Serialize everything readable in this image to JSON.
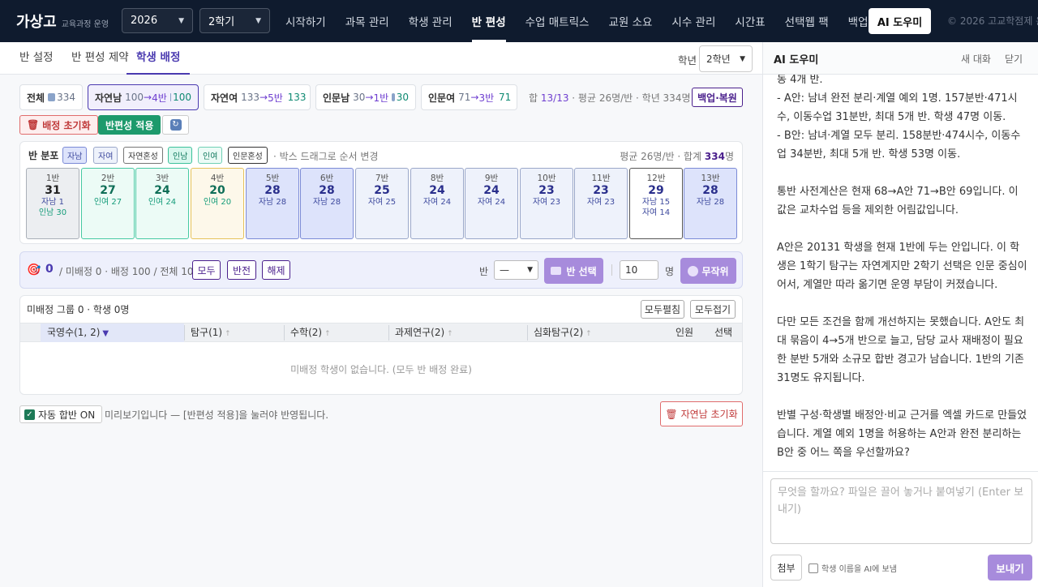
{
  "header": {
    "logo": "가상고",
    "logo_sub": "교육과정 운영",
    "year": "2026",
    "semester": "2학기",
    "nav": [
      "시작하기",
      "과목 관리",
      "학생 관리",
      "반 편성",
      "수업 매트릭스",
      "교원 소요",
      "시수 관리",
      "시간표",
      "선택웹 팩",
      "백업"
    ],
    "active_nav": "반 편성",
    "ai_button": "AI 도우미",
    "copyright": "© 2026 고교학점제 운영"
  },
  "subtabs": [
    "반 설정",
    "반 편성 제약",
    "학생 배정"
  ],
  "active_subtab": "학생 배정",
  "grade": {
    "label": "학년",
    "value": "2학년"
  },
  "filters": [
    {
      "label": "전체",
      "value": "334"
    },
    {
      "label": "자연남",
      "from": "100",
      "arrow": "→",
      "to": "4반",
      "value": "100"
    },
    {
      "label": "자연여",
      "from": "133",
      "arrow": "→",
      "to": "5반",
      "value": "133"
    },
    {
      "label": "인문남",
      "from": "30",
      "arrow": "→",
      "to": "1반",
      "value": "30"
    },
    {
      "label": "인문여",
      "from": "71",
      "arrow": "→",
      "to": "3반",
      "value": "71"
    }
  ],
  "summary": {
    "prefix": "합",
    "ratio": "13/13",
    "rest": "· 평균 26명/반 · 학년 334명"
  },
  "buttons": {
    "backup": "백업·복원",
    "reset": "배정 초기화",
    "apply": "반편성 적용"
  },
  "distribution": {
    "title": "반 분포",
    "legend": [
      "자남",
      "자여",
      "자연혼성",
      "인남",
      "인여",
      "인문혼성"
    ],
    "hint": "· 박스 드래그로 순서 변경",
    "total_prefix": "평균 26명/반 · 합계",
    "total": "334",
    "total_suffix": "명",
    "classes": [
      {
        "name": "1반",
        "count": "31",
        "lines": [
          "자남 1",
          "인남 30"
        ]
      },
      {
        "name": "2반",
        "count": "27",
        "lines": [
          "인여 27"
        ]
      },
      {
        "name": "3반",
        "count": "24",
        "lines": [
          "인여 24"
        ]
      },
      {
        "name": "4반",
        "count": "20",
        "lines": [
          "인여 20"
        ]
      },
      {
        "name": "5반",
        "count": "28",
        "lines": [
          "자남 28"
        ]
      },
      {
        "name": "6반",
        "count": "28",
        "lines": [
          "자남 28"
        ]
      },
      {
        "name": "7반",
        "count": "25",
        "lines": [
          "자여 25"
        ]
      },
      {
        "name": "8반",
        "count": "24",
        "lines": [
          "자여 24"
        ]
      },
      {
        "name": "9반",
        "count": "24",
        "lines": [
          "자여 24"
        ]
      },
      {
        "name": "10반",
        "count": "23",
        "lines": [
          "자여 23"
        ]
      },
      {
        "name": "11반",
        "count": "23",
        "lines": [
          "자여 23"
        ]
      },
      {
        "name": "12반",
        "count": "29",
        "lines": [
          "자남 15",
          "자여 14"
        ]
      },
      {
        "name": "13반",
        "count": "28",
        "lines": [
          "자남 28"
        ]
      }
    ]
  },
  "selection": {
    "count": "0",
    "text": "/ 미배정 0 · 배정 100 / 전체 100",
    "all": "모두",
    "invert": "반전",
    "clear": "해제",
    "ban_label": "반",
    "ban_value": "—",
    "ban_select": "반 선택",
    "num": "10",
    "num_unit": "명",
    "random": "무작위"
  },
  "unassigned": {
    "title": "미배정 그룹 0 · 학생 0명",
    "expand": "모두펼침",
    "collapse": "모두접기",
    "columns": [
      "국영수(1, 2)",
      "탐구(1)",
      "수학(2)",
      "과제연구(2)",
      "심화탐구(2)",
      "인원",
      "선택"
    ],
    "empty": "미배정 학생이 없습니다. (모두 반 배정 완료)"
  },
  "footer": {
    "auto_merge": "자동 합반 ON",
    "preview_note": "미리보기입니다 — [반편성 적용]을 눌러야 반영됩니다.",
    "reset_nature_m": "자연남 초기화"
  },
  "assistant": {
    "title": "AI 도우미",
    "new_chat": "새 대화",
    "close": "닫기",
    "message": "동 4개 반.\n- A안: 남녀 완전 분리·계열 예외 1명. 157분반·471시수, 이동수업 31분반, 최대 5개 반. 학생 47명 이동.\n- B안: 남녀·계열 모두 분리. 158분반·474시수, 이동수업 34분반, 최대 5개 반. 학생 53명 이동.\n\n통반 사전계산은 현재 68→A안 71→B안 69입니다. 이 값은 교차수업 등을 제외한 어림값입니다.\n\nA안은 20131 학생을 현재 1반에 두는 안입니다. 이 학생은 1학기 탐구는 자연계지만 2학기 선택은 인문 중심이어서, 계열만 따라 옮기면 운영 부담이 커졌습니다.\n\n다만 모든 조건을 함께 개선하지는 못했습니다. A안도 최대 묶음이 4→5개 반으로 늘고, 담당 교사 재배정이 필요한 분반 5개와 소규모 합반 경고가 남습니다. 1반의 기존 31명도 유지됩니다.\n\n반별 구성·학생별 배정안·비교 근거를 엑셀 카드로 만들었습니다. 계열 예외 1명을 허용하는 A안과 완전 분리하는 B안 중 어느 쪽을 우선할까요?",
    "input_placeholder": "무엇을 할까요? 파일은 끌어 놓거나 붙여넣기 (Enter 보내기)",
    "attach": "첨부",
    "send_name": "학생 이름을 AI에 보냄",
    "send": "보내기"
  }
}
